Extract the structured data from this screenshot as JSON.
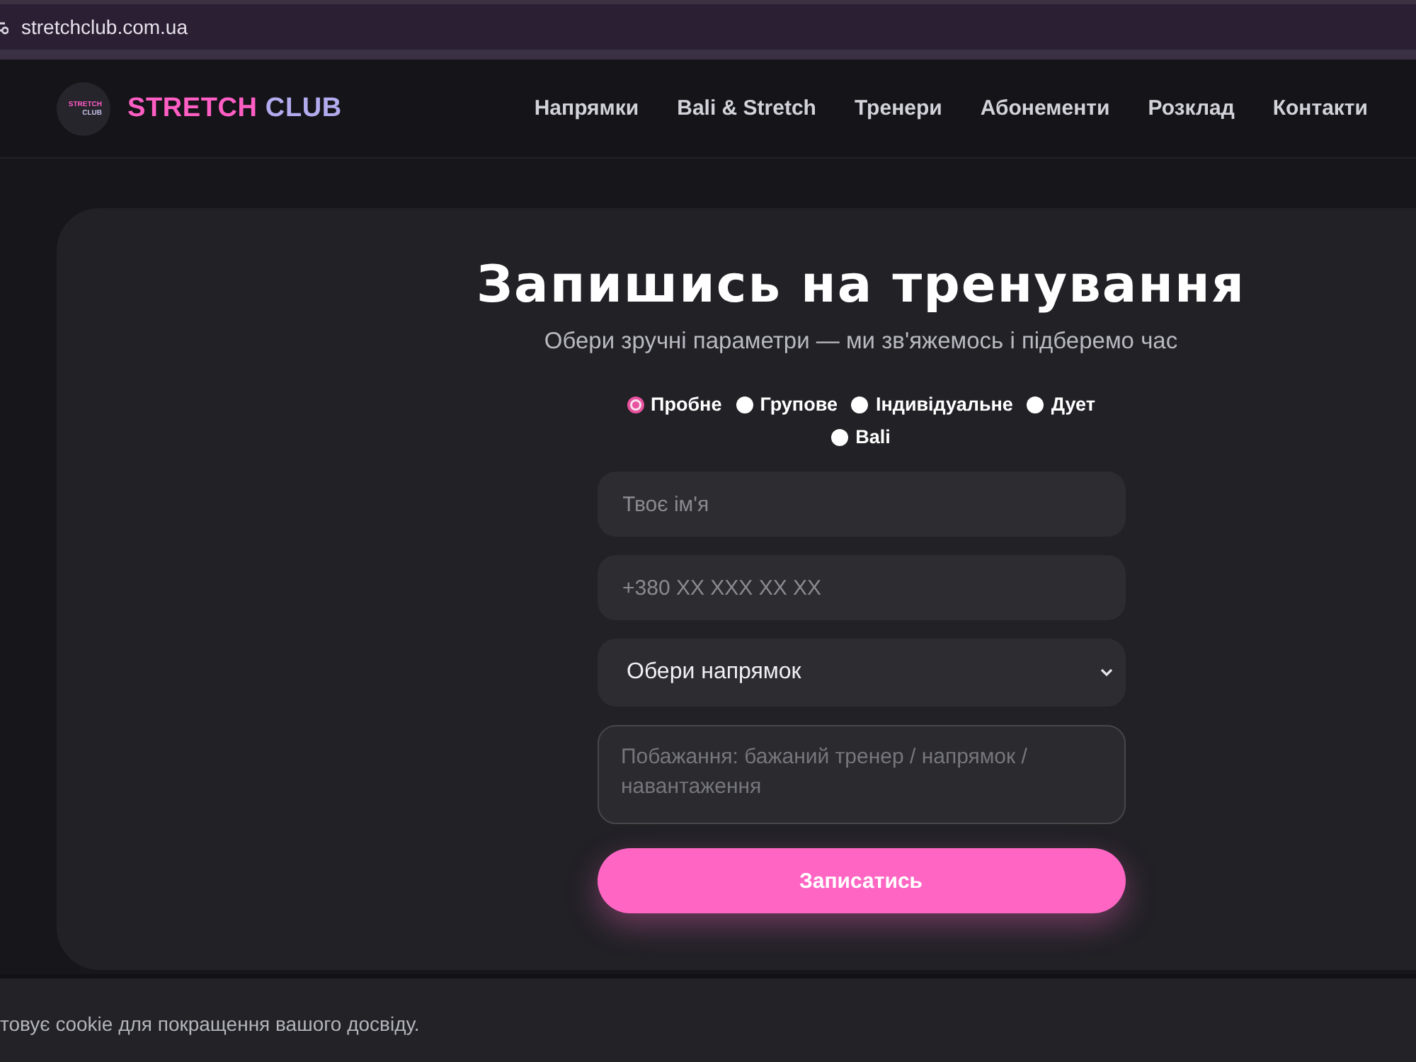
{
  "browser": {
    "url": "stretchclub.com.ua"
  },
  "header": {
    "logo_badge": [
      "STRETCH",
      "CLUB"
    ],
    "brand": {
      "primary": "STRETCH",
      "secondary": "CLUB"
    },
    "nav": [
      "Напрямки",
      "Bali & Stretch",
      "Тренери",
      "Абонементи",
      "Розклад",
      "Контакти"
    ]
  },
  "booking": {
    "title": "Запишись на тренування",
    "subtitle": "Обери зручні параметри — ми зв'яжемось і підберемо час",
    "options": [
      {
        "label": "Пробне",
        "selected": true
      },
      {
        "label": "Групове",
        "selected": false
      },
      {
        "label": "Індивідуальне",
        "selected": false
      },
      {
        "label": "Дует",
        "selected": false
      },
      {
        "label": "Bali",
        "selected": false
      }
    ],
    "fields": [
      {
        "kind": "input",
        "placeholder": "Твоє ім'я"
      },
      {
        "kind": "input",
        "placeholder": "+380 XX XXX XX XX"
      },
      {
        "kind": "select",
        "value": "Обери напрямок"
      },
      {
        "kind": "textarea",
        "placeholder": "Побажання: бажаний тренер / напрямок / навантаження"
      }
    ],
    "submit": "Записатись"
  },
  "cookie_bar": {
    "text": "товує cookie для покращення вашого досвіду."
  }
}
